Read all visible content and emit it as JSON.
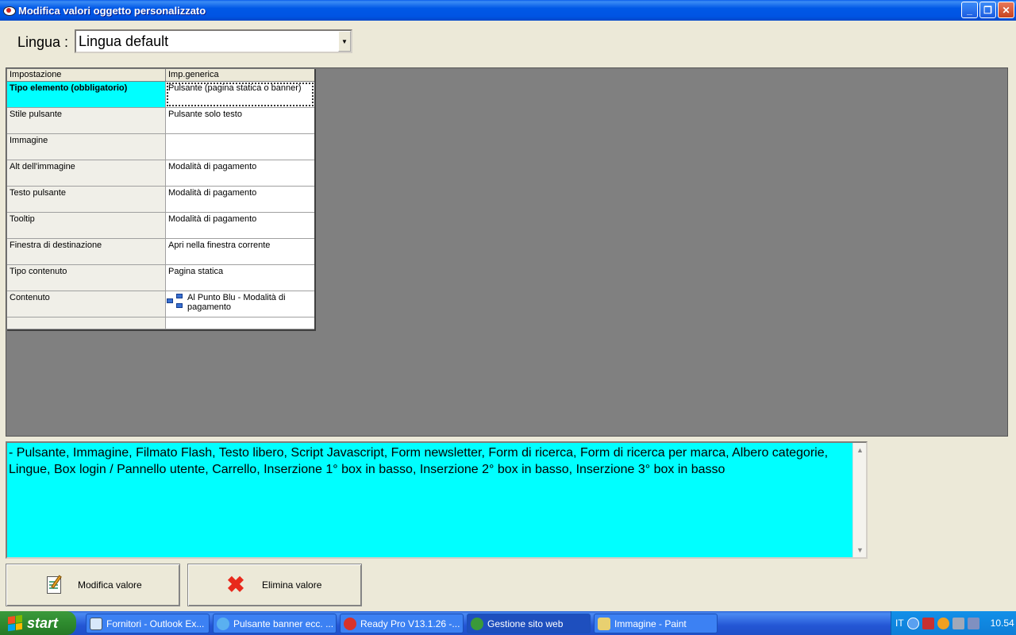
{
  "window": {
    "title": "Modifica valori oggetto personalizzato"
  },
  "language": {
    "label": "Lingua :",
    "value": "Lingua default"
  },
  "grid": {
    "headers": [
      "Impostazione",
      "Imp.generica"
    ],
    "rows": [
      {
        "setting": "Tipo elemento (obbligatorio)",
        "value": "Pulsante (pagina statica o banner)"
      },
      {
        "setting": "Stile pulsante",
        "value": "Pulsante solo testo"
      },
      {
        "setting": "Immagine",
        "value": ""
      },
      {
        "setting": "Alt dell'immagine",
        "value": "Modalità di pagamento"
      },
      {
        "setting": "Testo pulsante",
        "value": "Modalità di pagamento"
      },
      {
        "setting": "Tooltip",
        "value": "Modalità di pagamento"
      },
      {
        "setting": "Finestra di destinazione",
        "value": "Apri nella finestra corrente"
      },
      {
        "setting": "Tipo contenuto",
        "value": "Pagina statica"
      },
      {
        "setting": "Contenuto",
        "value": "Al Punto Blu - Modalità di pagamento",
        "icon": "tree-icon"
      }
    ]
  },
  "description": "- Pulsante, Immagine, Filmato Flash, Testo libero, Script Javascript, Form newsletter, Form di ricerca, Form di ricerca per marca, Albero categorie, Lingue, Box login / Pannello utente, Carrello, Inserzione 1° box in basso, Inserzione 2° box in basso, Inserzione 3° box in basso",
  "buttons": {
    "modify": "Modifica valore",
    "delete": "Elimina valore"
  },
  "taskbar": {
    "start": "start",
    "tasks": [
      {
        "label": "Fornitori - Outlook Ex...",
        "icon": "outlook-icon"
      },
      {
        "label": "Pulsante banner ecc. ...",
        "icon": "ie-icon"
      },
      {
        "label": "Ready Pro V13.1.26 -...",
        "icon": "readypro-icon"
      },
      {
        "label": "Gestione sito web",
        "icon": "globe-icon"
      },
      {
        "label": "Immagine - Paint",
        "icon": "paint-icon"
      }
    ],
    "tray": {
      "lang": "IT",
      "clock": "10.54"
    }
  },
  "colors": {
    "selected": "#00FFFF",
    "grid_bg": "#808080",
    "description_bg": "#00FFFF"
  }
}
